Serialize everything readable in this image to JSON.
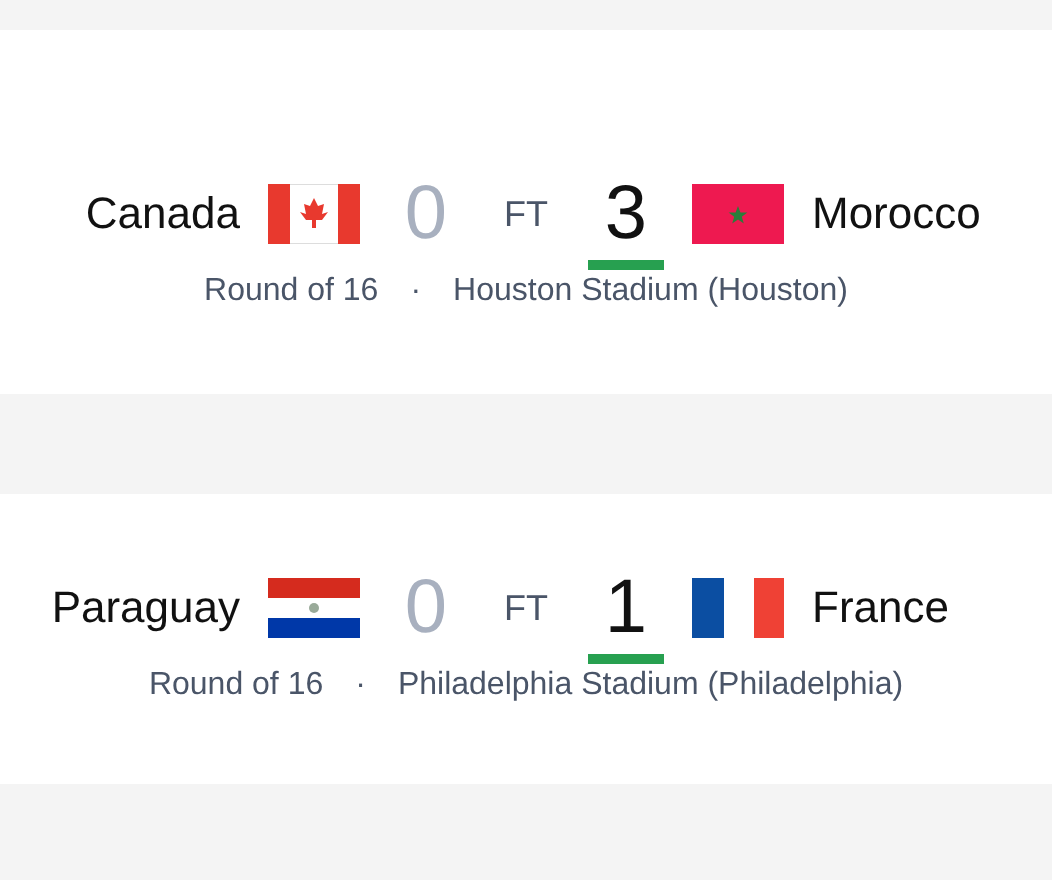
{
  "matches": [
    {
      "home": {
        "name": "Canada",
        "flag": {
          "kind": "canada"
        },
        "score": "0",
        "winner": false
      },
      "status": "FT",
      "away": {
        "name": "Morocco",
        "flag": {
          "kind": "morocco"
        },
        "score": "3",
        "winner": true
      },
      "round": "Round of 16",
      "separator": "·",
      "venue": "Houston Stadium (Houston)"
    },
    {
      "home": {
        "name": "Paraguay",
        "flag": {
          "kind": "paraguay"
        },
        "score": "0",
        "winner": false
      },
      "status": "FT",
      "away": {
        "name": "France",
        "flag": {
          "kind": "france"
        },
        "score": "1",
        "winner": true
      },
      "round": "Round of 16",
      "separator": "·",
      "venue": "Philadelphia Stadium (Philadelphia)"
    }
  ]
}
